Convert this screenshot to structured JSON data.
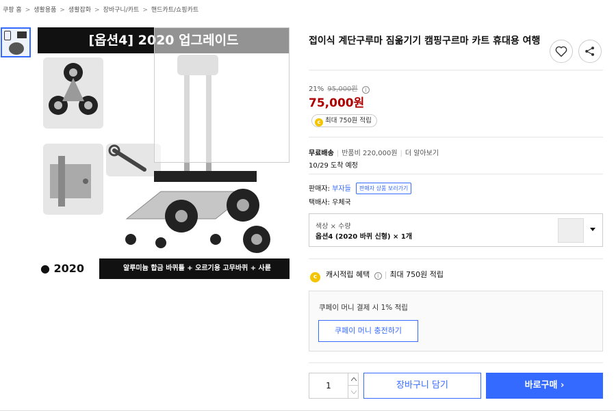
{
  "breadcrumb": [
    "쿠팡 홈",
    "생활용품",
    "생활잡화",
    "장바구니/카트",
    "핸드카트/쇼핑카트"
  ],
  "breadcrumb_sep": ">",
  "image": {
    "banner": "[옵션4] 2020 업그레이드",
    "year": "● 2020",
    "desc": "알루미늄 합금 바퀴틀 + 오르기용 고무바퀴 + 사륜"
  },
  "product": {
    "title": "접이식 계단구루마 짐옮기기 캠핑구르마 카트 휴대용 여행",
    "discount_rate": "21%",
    "original_price": "95,000원",
    "price": "75,000원",
    "reward": "최대 750원 적립"
  },
  "shipping": {
    "free": "무료배송",
    "return_fee": "반품비 220,000원",
    "more": "더 알아보기",
    "arrival": "10/29 도착 예정"
  },
  "seller": {
    "label": "판매자:",
    "name": "부자들",
    "button": "판매자 상품 보러가기",
    "courier": "택배사: 우체국"
  },
  "option": {
    "label": "색상 × 수량",
    "value": "옵션4 (2020 바퀴 신형) × 1개"
  },
  "cash": {
    "label": "캐시적립 혜택",
    "value": "최대 750원 적립"
  },
  "coupay": {
    "text": "쿠페이 머니 결제 시 1% 적립",
    "charge": "쿠페이 머니 충전하기"
  },
  "purchase": {
    "quantity": "1",
    "cart": "장바구니 담기",
    "buy": "바로구매 ›"
  },
  "colors": {
    "accent": "#346aff",
    "price": "#ae0000",
    "coin": "#f5c400"
  },
  "icons": [
    "heart-icon",
    "share-icon",
    "info-icon",
    "coin-icon",
    "chevron-down-icon",
    "chevron-up-icon"
  ]
}
